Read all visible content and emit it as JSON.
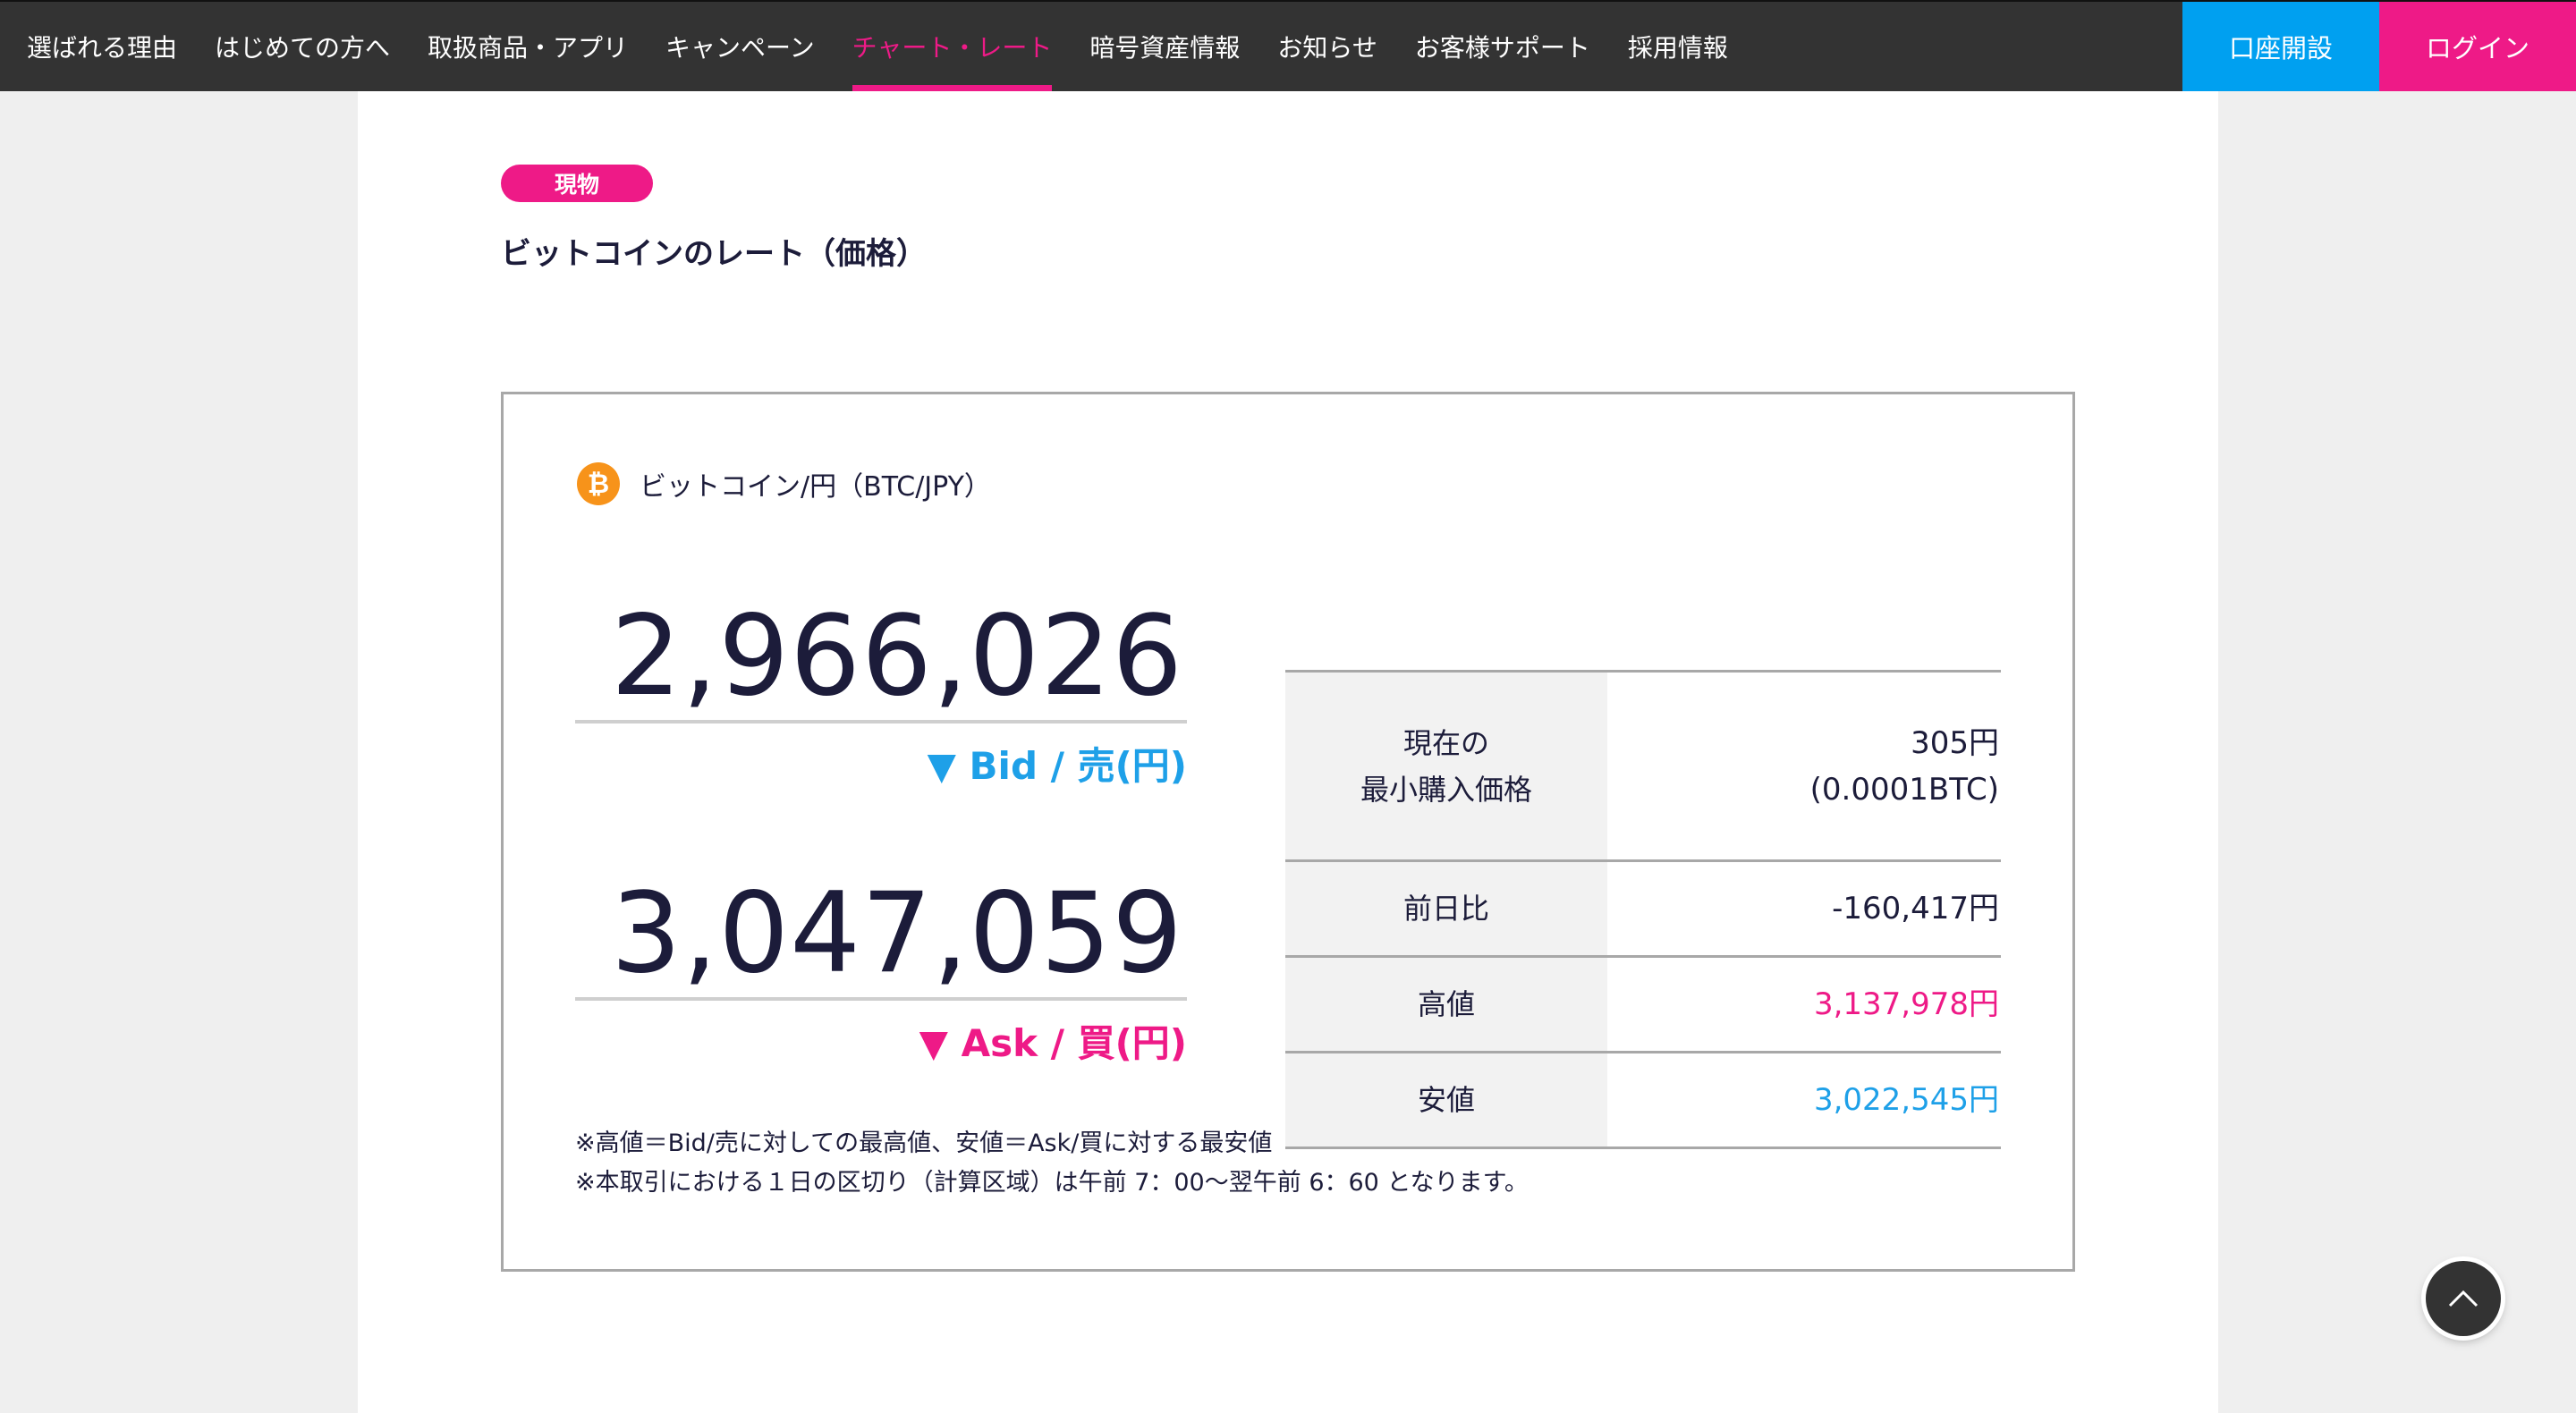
{
  "nav": {
    "items": [
      {
        "label": "選ばれる理由",
        "name": "nav-item-reasons",
        "active": false
      },
      {
        "label": "はじめての方へ",
        "name": "nav-item-beginners",
        "active": false
      },
      {
        "label": "取扱商品・アプリ",
        "name": "nav-item-products",
        "active": false
      },
      {
        "label": "キャンペーン",
        "name": "nav-item-campaign",
        "active": false
      },
      {
        "label": "チャート・レート",
        "name": "nav-item-chart-rate",
        "active": true
      },
      {
        "label": "暗号資産情報",
        "name": "nav-item-crypto-info",
        "active": false
      },
      {
        "label": "お知らせ",
        "name": "nav-item-news",
        "active": false
      },
      {
        "label": "お客様サポート",
        "name": "nav-item-support",
        "active": false
      },
      {
        "label": "採用情報",
        "name": "nav-item-careers",
        "active": false
      }
    ],
    "open_account_label": "口座開設",
    "login_label": "ログイン"
  },
  "page": {
    "badge": "現物",
    "title": "ビットコインのレート（価格）"
  },
  "rate": {
    "pair_icon": "bitcoin-icon",
    "pair_icon_glyph": "₿",
    "pair_label": "ビットコイン/円（BTC/JPY）",
    "bid_value": "2,966,026",
    "bid_label": "▼ Bid / 売(円)",
    "ask_value": "3,047,059",
    "ask_label": "▼ Ask / 買(円)",
    "table": {
      "min_price_head_1": "現在の",
      "min_price_head_2": "最小購入価格",
      "min_price_val_1": "305円",
      "min_price_val_2": "(0.0001BTC)",
      "change_head": "前日比",
      "change_val": "-160,417円",
      "high_head": "高値",
      "high_val": "3,137,978円",
      "low_head": "安値",
      "low_val": "3,022,545円"
    },
    "notes": [
      "※高値＝Bid/売に対しての最高値、安値＝Ask/買に対する最安値",
      "※本取引における１日の区切り（計算区域）は午前 7：00〜翌午前 6：60 となります。"
    ]
  },
  "colors": {
    "nav_bg": "#333333",
    "accent_pink": "#ee1a87",
    "accent_blue": "#00a0f0",
    "bitcoin_orange": "#f7931a"
  },
  "to_top_icon": "chevron-up-icon"
}
